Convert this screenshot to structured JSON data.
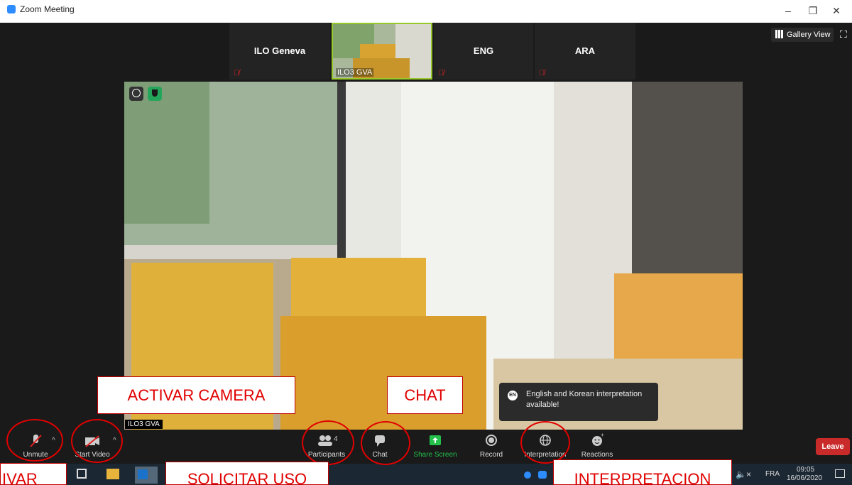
{
  "window": {
    "title": "Zoom Meeting",
    "minimize": "–",
    "restore": "❐",
    "close": "✕"
  },
  "gallery": {
    "label": "Gallery View"
  },
  "participants_strip": [
    {
      "name": "ILO Geneva"
    },
    {
      "name": "ENG"
    },
    {
      "name": "ARA"
    }
  ],
  "video_thumb": {
    "name": "ILO3 GVA"
  },
  "main_video": {
    "name_tag": "ILO3 GVA"
  },
  "notice": {
    "badge": "EN",
    "text": "English and Korean interpretation available!"
  },
  "toolbar": {
    "unmute": "Unmute",
    "start_video": "Start Video",
    "participants": "Participants",
    "participants_count": "4",
    "chat": "Chat",
    "share_screen": "Share Screen",
    "record": "Record",
    "interpretation": "Interpretation",
    "reactions": "Reactions",
    "leave": "Leave"
  },
  "taskbar": {
    "language": "FRA",
    "time": "09:05",
    "date": "16/06/2020"
  },
  "annotations": {
    "activar_camera": "ACTIVAR CAMERA",
    "chat": "CHAT",
    "activar": "IVAR",
    "solicitar": "SOLICITAR USO",
    "interpretacion": "INTERPRETACION"
  },
  "colors": {
    "accent": "#2d8cff",
    "share": "#23c04b",
    "leave": "#c92a2a",
    "annotation": "#e00000"
  }
}
